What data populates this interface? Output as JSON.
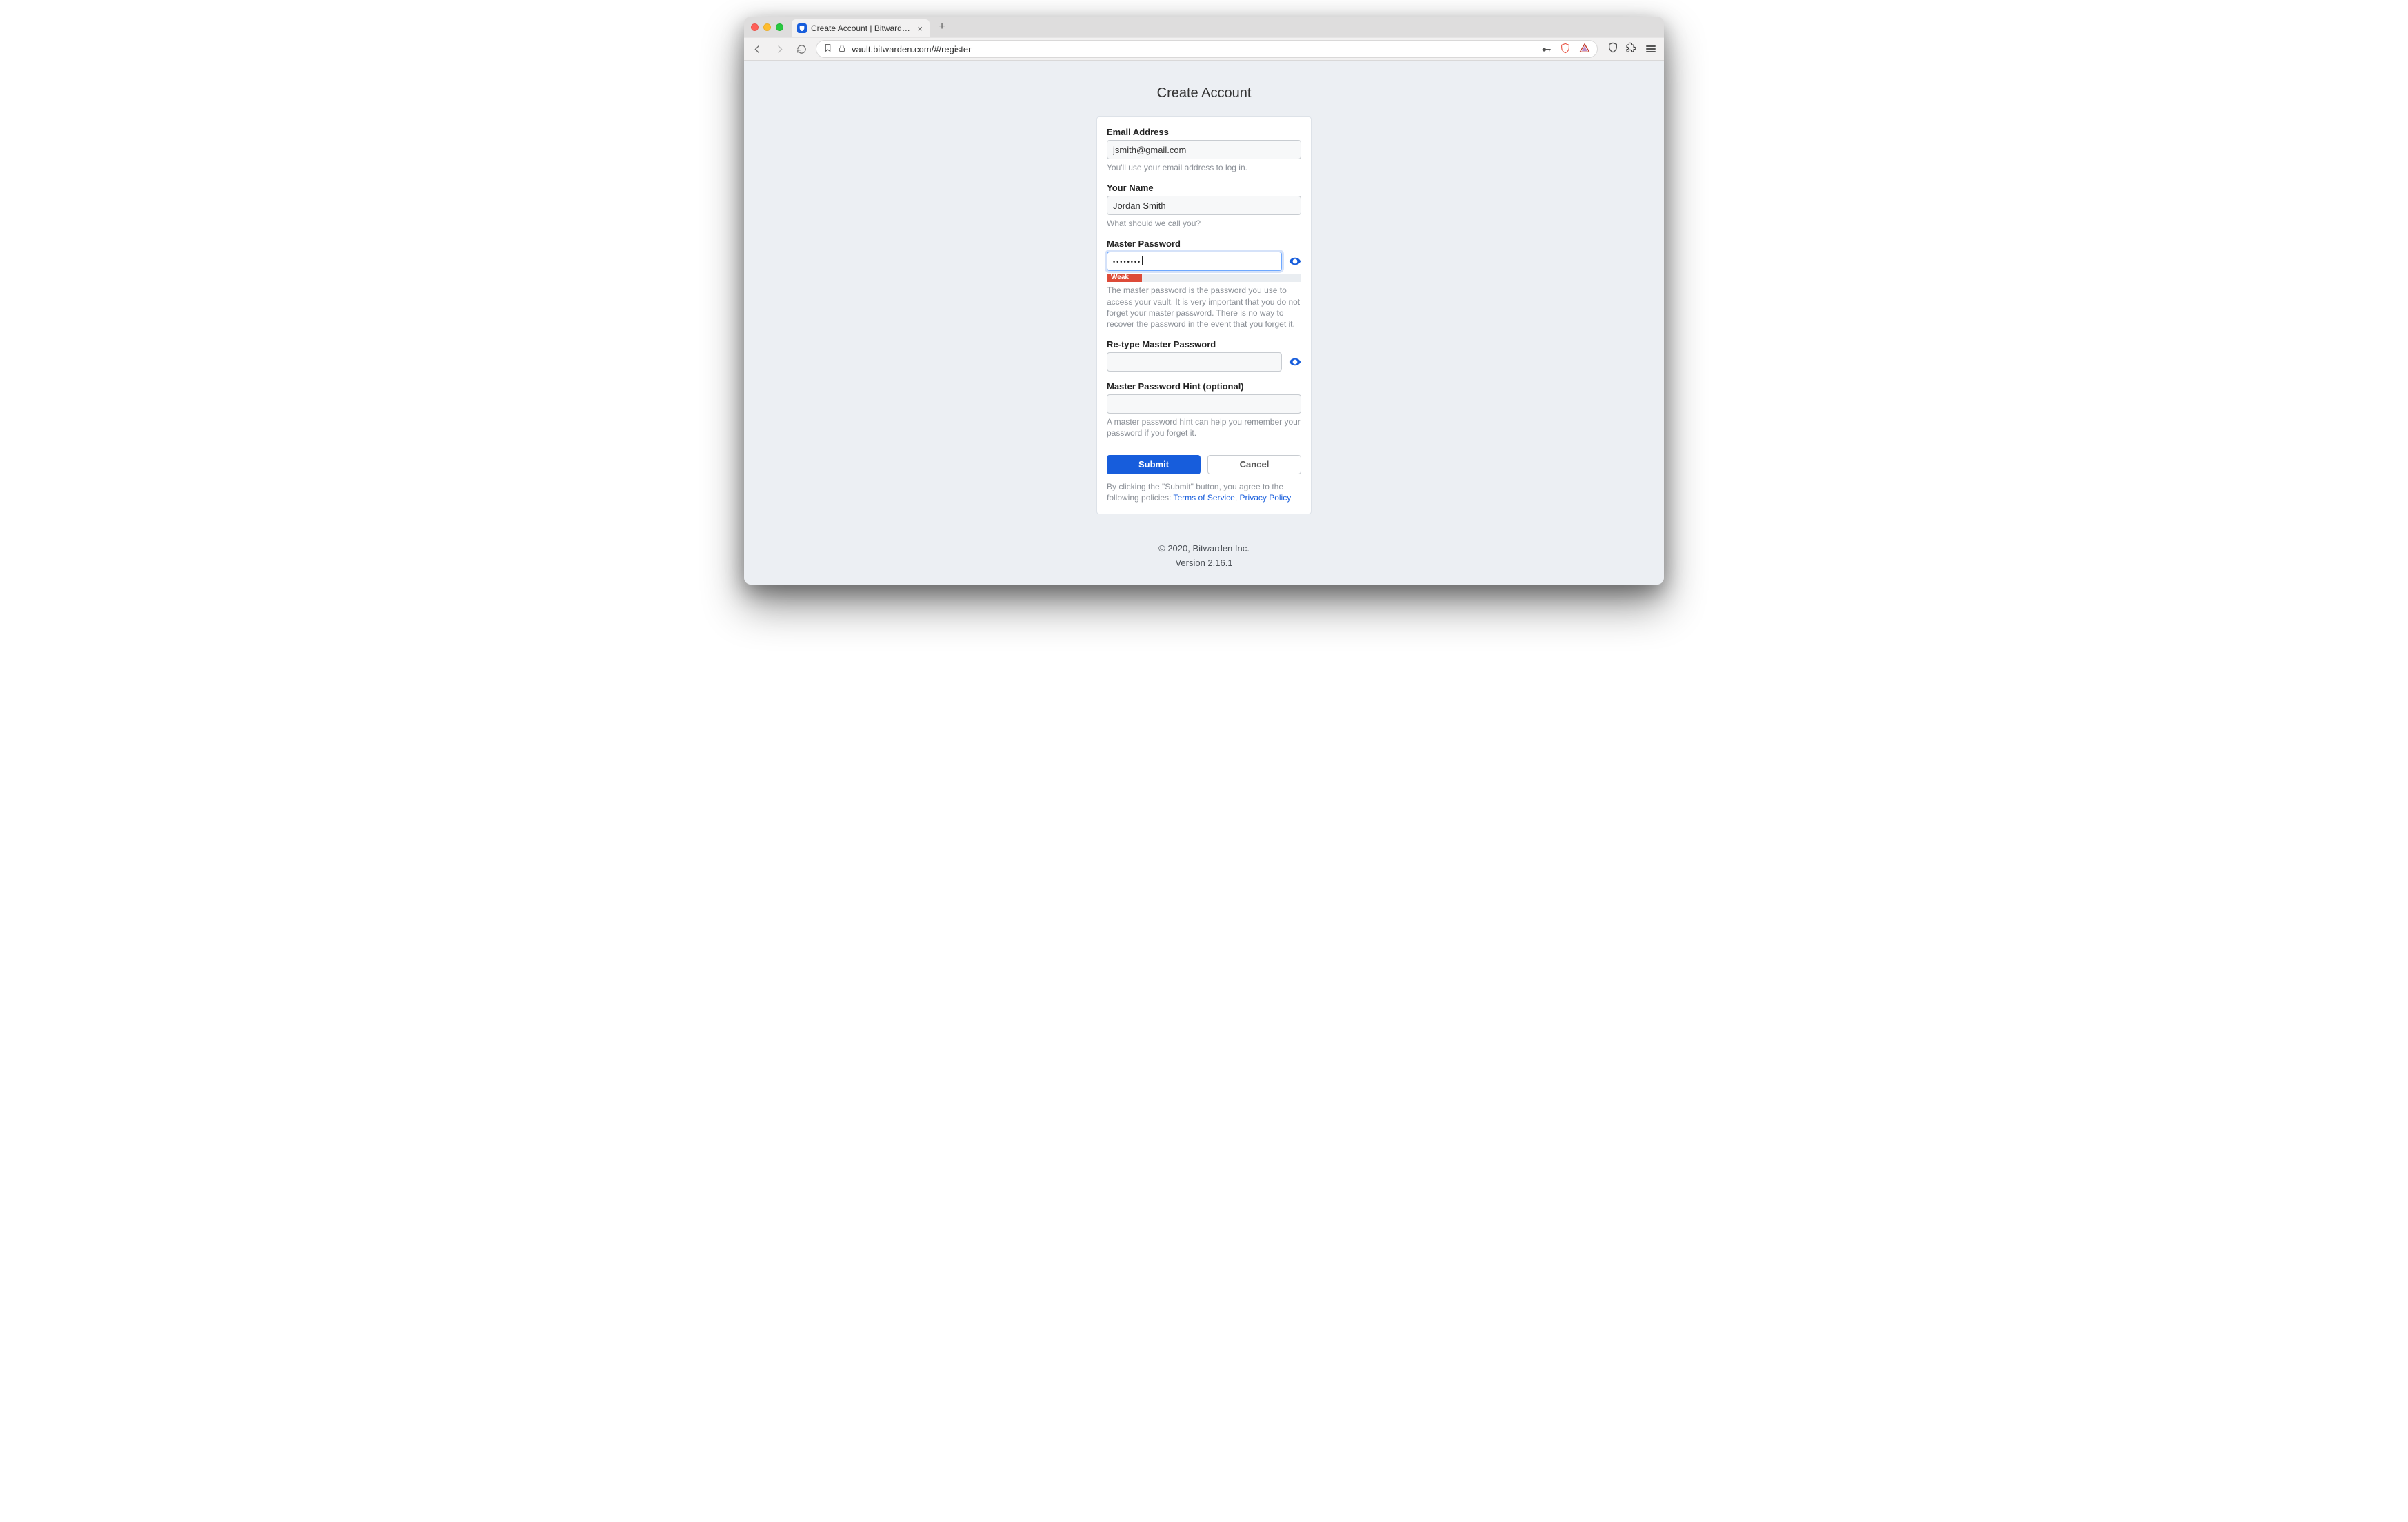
{
  "browser": {
    "tab_title": "Create Account | Bitwarden Web",
    "url": "vault.bitwarden.com/#/register"
  },
  "page": {
    "title": "Create Account"
  },
  "form": {
    "email": {
      "label": "Email Address",
      "value": "jsmith@gmail.com",
      "hint": "You'll use your email address to log in."
    },
    "name": {
      "label": "Your Name",
      "value": "Jordan Smith",
      "hint": "What should we call you?"
    },
    "master_password": {
      "label": "Master Password",
      "value_masked": "••••••••",
      "strength_label": "Weak",
      "hint": "The master password is the password you use to access your vault. It is very important that you do not forget your master password. There is no way to recover the password in the event that you forget it."
    },
    "retype": {
      "label": "Re-type Master Password",
      "value": ""
    },
    "hint_field": {
      "label": "Master Password Hint (optional)",
      "value": "",
      "hint": "A master password hint can help you remember your password if you forget it."
    },
    "submit_label": "Submit",
    "cancel_label": "Cancel",
    "agree_prefix": "By clicking the \"Submit\" button, you agree to the following policies: ",
    "tos_label": "Terms of Service",
    "sep": ", ",
    "privacy_label": "Privacy Policy"
  },
  "footer": {
    "copyright": "© 2020, Bitwarden Inc.",
    "version": "Version 2.16.1"
  }
}
